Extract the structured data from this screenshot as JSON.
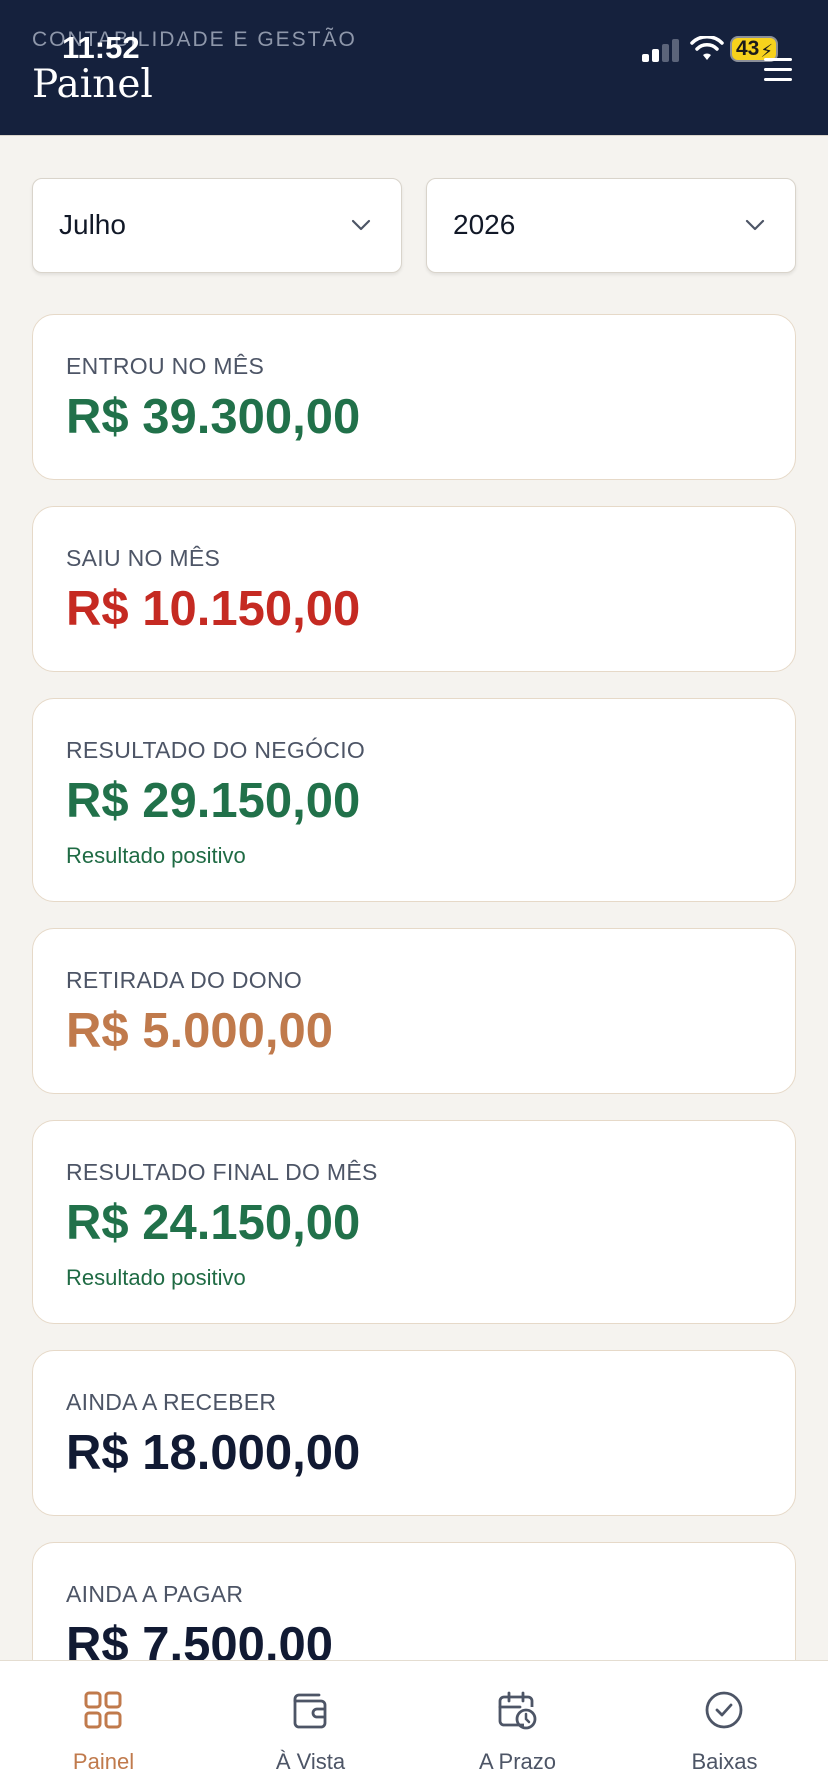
{
  "status_bar": {
    "time": "11:52",
    "battery": "43"
  },
  "header": {
    "subtitle": "CONTABILIDADE E GESTÃO",
    "title": "Painel"
  },
  "filters": {
    "month": {
      "selected": "Julho"
    },
    "year": {
      "selected": "2026"
    }
  },
  "cards": [
    {
      "label": "ENTROU NO MÊS",
      "value": "R$ 39.300,00",
      "color": "#21714a"
    },
    {
      "label": "SAIU NO MÊS",
      "value": "R$ 10.150,00",
      "color": "#c52a22"
    },
    {
      "label": "RESULTADO DO NEGÓCIO",
      "value": "R$ 29.150,00",
      "note": "Resultado positivo",
      "color": "#21714a"
    },
    {
      "label": "RETIRADA DO DONO",
      "value": "R$ 5.000,00",
      "color": "#c07a4c"
    },
    {
      "label": "RESULTADO FINAL DO MÊS",
      "value": "R$ 24.150,00",
      "note": "Resultado positivo",
      "color": "#21714a"
    },
    {
      "label": "AINDA A RECEBER",
      "value": "R$ 18.000,00",
      "color": "#111a33"
    },
    {
      "label": "AINDA A PAGAR",
      "value": "R$ 7.500,00",
      "color": "#111a33"
    }
  ],
  "bottom_nav": [
    {
      "label": "Painel",
      "icon": "grid-icon",
      "active": true
    },
    {
      "label": "À Vista",
      "icon": "wallet-icon",
      "active": false
    },
    {
      "label": "A Prazo",
      "icon": "calendar-clock-icon",
      "active": false
    },
    {
      "label": "Baixas",
      "icon": "check-circle-icon",
      "active": false
    }
  ],
  "colors": {
    "header_bg": "#15213d",
    "accent": "#c07a4c",
    "positive": "#21714a",
    "negative": "#c52a22",
    "page_bg": "#f5f3ef"
  }
}
